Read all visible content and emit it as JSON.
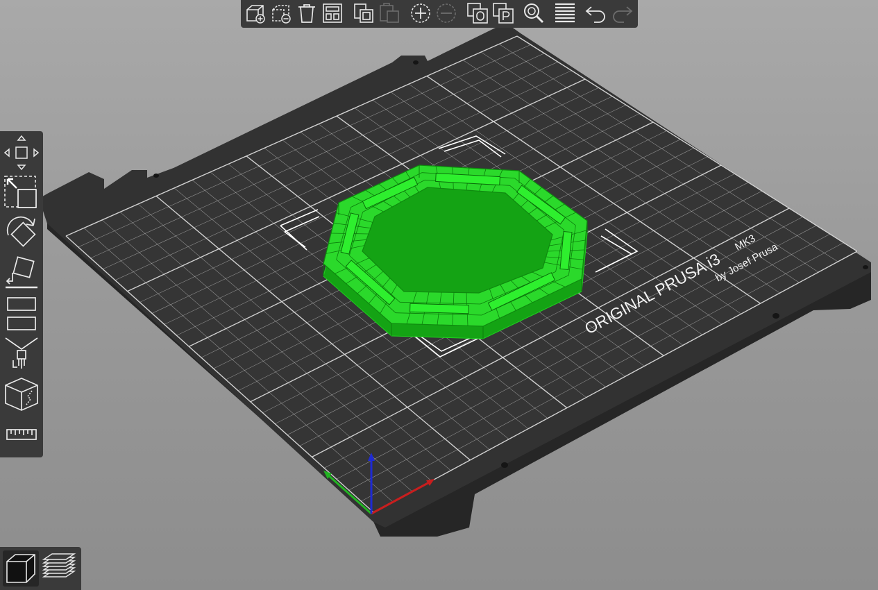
{
  "scene": {
    "bed_brand_line": "ORIGINAL PRUSA i3",
    "bed_model": "MK3",
    "bed_author": "by Josef Prusa",
    "model_color": "#1fd01f",
    "bed_color": "#2f2f2f",
    "axis_colors": {
      "x": "#c81e1e",
      "y": "#22b422",
      "z": "#1e2ad2"
    }
  },
  "toolbar_top": {
    "buttons": [
      {
        "name": "add-icon"
      },
      {
        "name": "delete-icon"
      },
      {
        "name": "delete-all-icon"
      },
      {
        "name": "arrange-icon"
      },
      {
        "name": "copy-icon"
      },
      {
        "name": "paste-icon"
      },
      {
        "name": "add-instance-icon"
      },
      {
        "name": "remove-instance-icon"
      },
      {
        "name": "split-to-objects-icon"
      },
      {
        "name": "split-to-parts-icon"
      },
      {
        "name": "search-icon"
      },
      {
        "name": "layers-editing-icon"
      },
      {
        "name": "undo-icon"
      },
      {
        "name": "redo-icon"
      }
    ]
  },
  "toolbar_left": {
    "tools": [
      {
        "name": "move-icon"
      },
      {
        "name": "scale-icon"
      },
      {
        "name": "rotate-icon"
      },
      {
        "name": "place-on-face-icon"
      },
      {
        "name": "cut-icon"
      },
      {
        "name": "support-paint-icon"
      },
      {
        "name": "seam-paint-icon"
      },
      {
        "name": "measure-icon"
      }
    ]
  },
  "view_switch": {
    "active": "3d",
    "buttons": [
      {
        "name": "3d-view-icon"
      },
      {
        "name": "preview-layers-icon"
      }
    ]
  }
}
